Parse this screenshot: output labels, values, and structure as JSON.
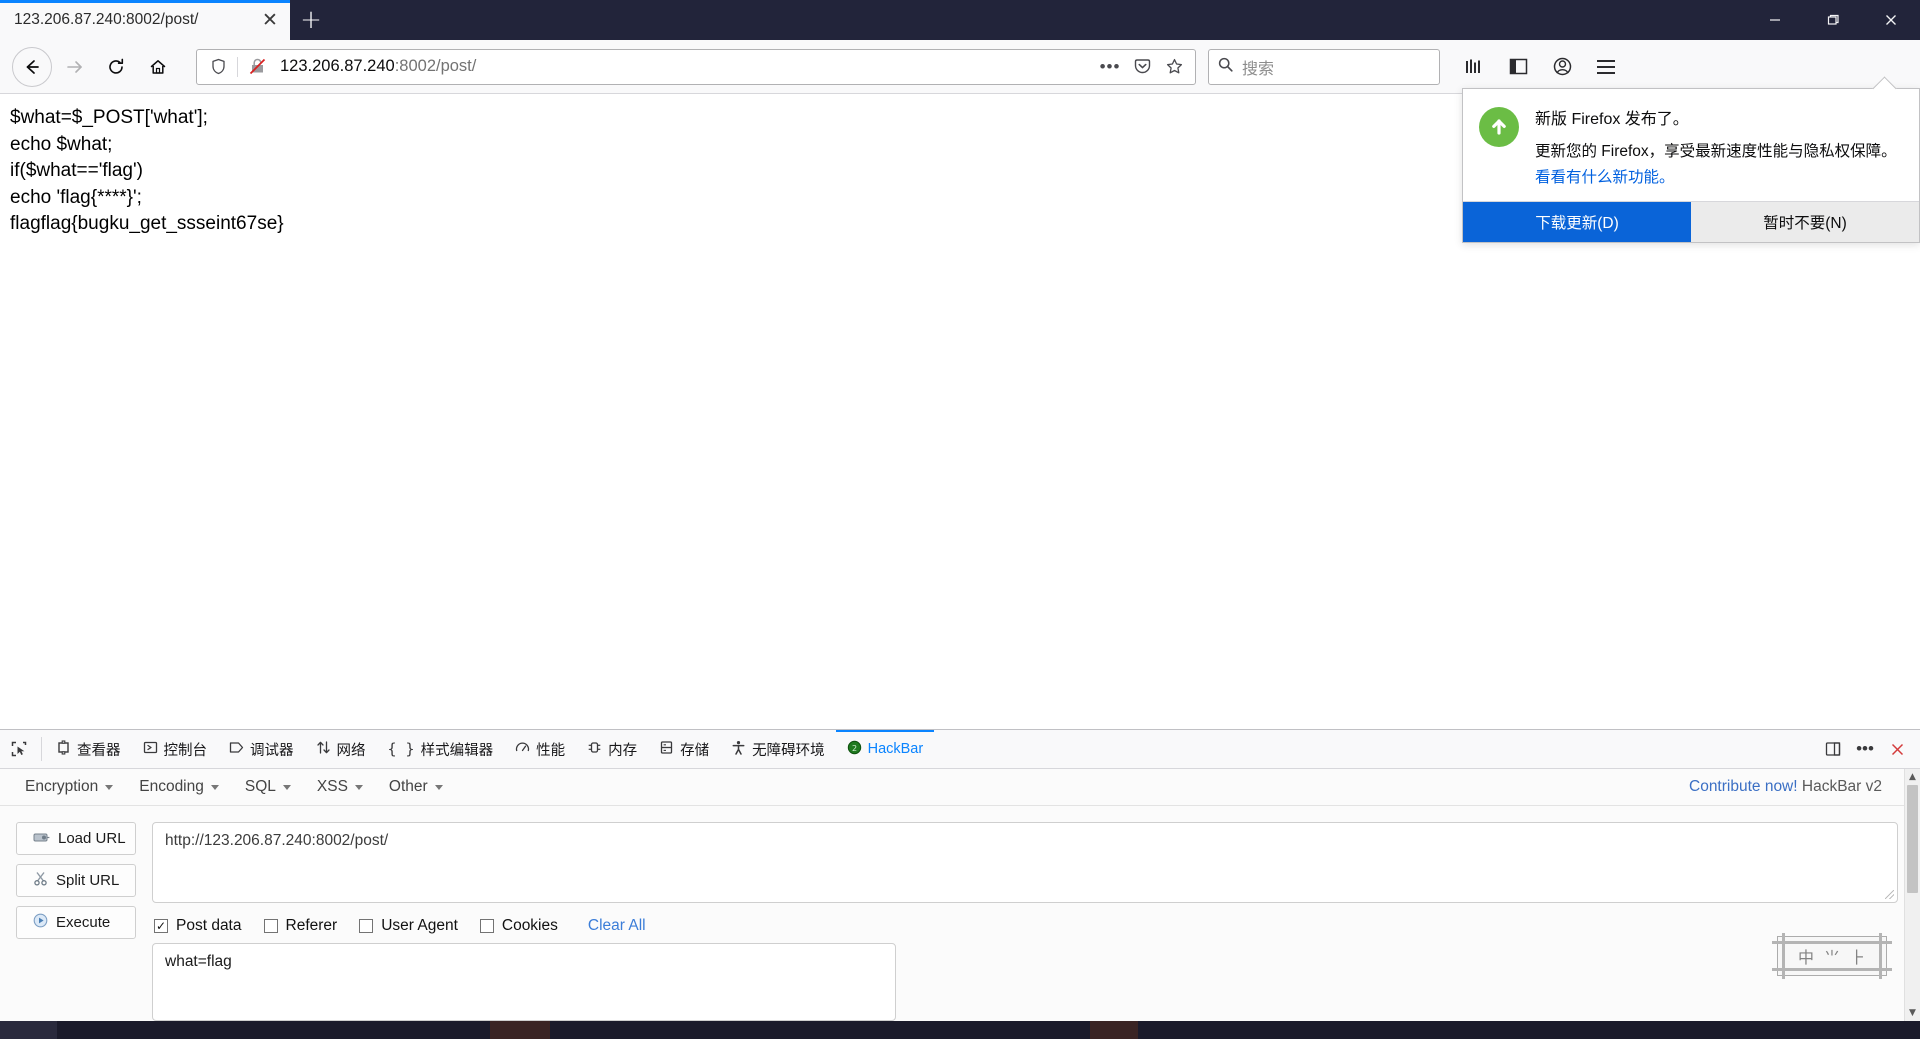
{
  "browser": {
    "tab": {
      "title": "123.206.87.240:8002/post/",
      "close_label": "✕"
    },
    "new_tab_label": "+",
    "window_controls": {
      "minimize": "—",
      "maximize": "❐",
      "close": "✕"
    },
    "nav": {
      "back": "back-arrow",
      "forward": "forward-arrow",
      "reload": "reload-arrow",
      "home": "home-house"
    },
    "urlbar": {
      "host": "123.206.87.240",
      "rest": ":8002/post/",
      "shield_icon": "tracking-protection-shield",
      "broken_lock_icon": "insecure-connection",
      "page_actions_label": "•••",
      "pocket_icon": "save-to-pocket",
      "bookmark_icon": "bookmark-star"
    },
    "search": {
      "placeholder": "搜索",
      "icon": "magnifier"
    },
    "toolbar_right": {
      "library": "library-icon",
      "sidebars": "sidebar-icon",
      "account": "account-icon",
      "menu": "hamburger-menu"
    }
  },
  "page": {
    "lines": [
      "$what=$_POST['what'];",
      "echo $what;",
      "if($what=='flag')",
      "echo 'flag{****}';",
      "flagflag{bugku_get_ssseint67se}"
    ]
  },
  "notification": {
    "icon": "update-arrow-up",
    "title": "新版 Firefox 发布了。",
    "description": "更新您的 Firefox，享受最新速度性能与隐私权保障。",
    "link": "看看有什么新功能。",
    "primary_button": "下载更新(D)",
    "primary_button_accesskey": "D",
    "secondary_button": "暂时不要(N)",
    "secondary_button_accesskey": "N"
  },
  "devtools": {
    "picker_icon": "element-picker",
    "tabs": [
      {
        "label": "查看器",
        "icon": "inspector-icon",
        "active": false
      },
      {
        "label": "控制台",
        "icon": "console-icon",
        "active": false
      },
      {
        "label": "调试器",
        "icon": "debugger-icon",
        "active": false
      },
      {
        "label": "网络",
        "icon": "network-icon",
        "active": false
      },
      {
        "label": "样式编辑器",
        "icon": "style-editor-icon",
        "active": false
      },
      {
        "label": "性能",
        "icon": "performance-icon",
        "active": false
      },
      {
        "label": "内存",
        "icon": "memory-icon",
        "active": false
      },
      {
        "label": "存储",
        "icon": "storage-icon",
        "active": false
      },
      {
        "label": "无障碍环境",
        "icon": "accessibility-icon",
        "active": false
      },
      {
        "label": "HackBar",
        "icon": "hackbar-icon",
        "active": true
      }
    ],
    "right_icons": {
      "dock": "dock-panel-icon",
      "more": "•••",
      "close": "✕"
    },
    "active_accent": "#0a84ff"
  },
  "hackbar": {
    "menus": [
      "Encryption",
      "Encoding",
      "SQL",
      "XSS",
      "Other"
    ],
    "contribute_link": "Contribute now!",
    "version_label": "HackBar v2",
    "buttons": [
      {
        "label": "Load URL",
        "icon": "load-url-icon"
      },
      {
        "label": "Split URL",
        "icon": "split-url-icon"
      },
      {
        "label": "Execute",
        "icon": "execute-play-icon"
      }
    ],
    "url_value": "http://123.206.87.240:8002/post/",
    "checkboxes": [
      {
        "label": "Post data",
        "checked": true
      },
      {
        "label": "Referer",
        "checked": false
      },
      {
        "label": "User Agent",
        "checked": false
      },
      {
        "label": "Cookies",
        "checked": false
      }
    ],
    "clear_all_label": "Clear All",
    "post_data_value": "what=flag"
  },
  "ime": {
    "mode": "中",
    "glyph2": "⺌",
    "glyph3": "⺊"
  },
  "colors": {
    "accent_blue": "#0a84ff",
    "primary_button": "#0a64d8",
    "link_blue": "#0060df",
    "update_green": "#6bbd45",
    "chrome_bg": "#f9f9fa",
    "titlebar_bg": "#22243a"
  }
}
